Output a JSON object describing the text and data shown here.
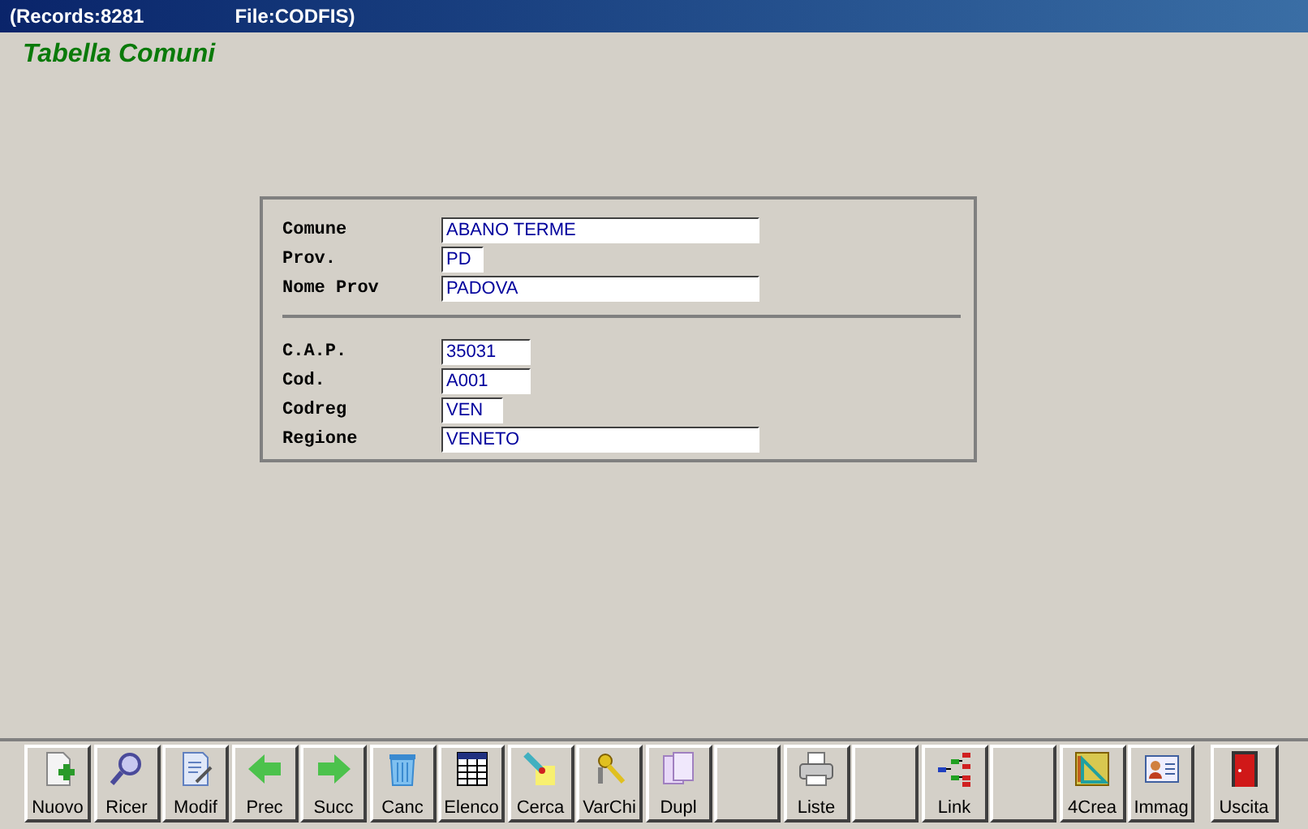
{
  "window": {
    "title_records": "(Records:8281",
    "title_file": "File:CODFIS)"
  },
  "heading": "Tabella Comuni",
  "form": {
    "sections": [
      [
        {
          "label": "Comune",
          "value": "ABANO TERME"
        },
        {
          "label": "Prov.",
          "value": "PD"
        },
        {
          "label": "Nome Prov",
          "value": "PADOVA"
        }
      ],
      [
        {
          "label": "C.A.P.",
          "value": "35031"
        },
        {
          "label": "Cod.",
          "value": "A001"
        },
        {
          "label": "Codreg",
          "value": "VEN"
        },
        {
          "label": "Regione",
          "value": "VENETO"
        }
      ]
    ]
  },
  "toolbar": {
    "buttons": [
      {
        "kind": "button",
        "label": "Nuovo"
      },
      {
        "kind": "button",
        "label": "Ricer"
      },
      {
        "kind": "button",
        "label": "Modif"
      },
      {
        "kind": "button",
        "label": "Prec"
      },
      {
        "kind": "button",
        "label": "Succ"
      },
      {
        "kind": "button",
        "label": "Canc"
      },
      {
        "kind": "button",
        "label": "Elenco"
      },
      {
        "kind": "button",
        "label": "Cerca"
      },
      {
        "kind": "button",
        "label": "VarChi"
      },
      {
        "kind": "button",
        "label": "Dupl"
      },
      {
        "kind": "blank"
      },
      {
        "kind": "button",
        "label": "Liste"
      },
      {
        "kind": "blank"
      },
      {
        "kind": "button",
        "label": "Link"
      },
      {
        "kind": "blank"
      },
      {
        "kind": "button",
        "label": "4Crea"
      },
      {
        "kind": "button",
        "label": "Immag"
      }
    ],
    "exit_button": {
      "label": "Uscita"
    }
  }
}
